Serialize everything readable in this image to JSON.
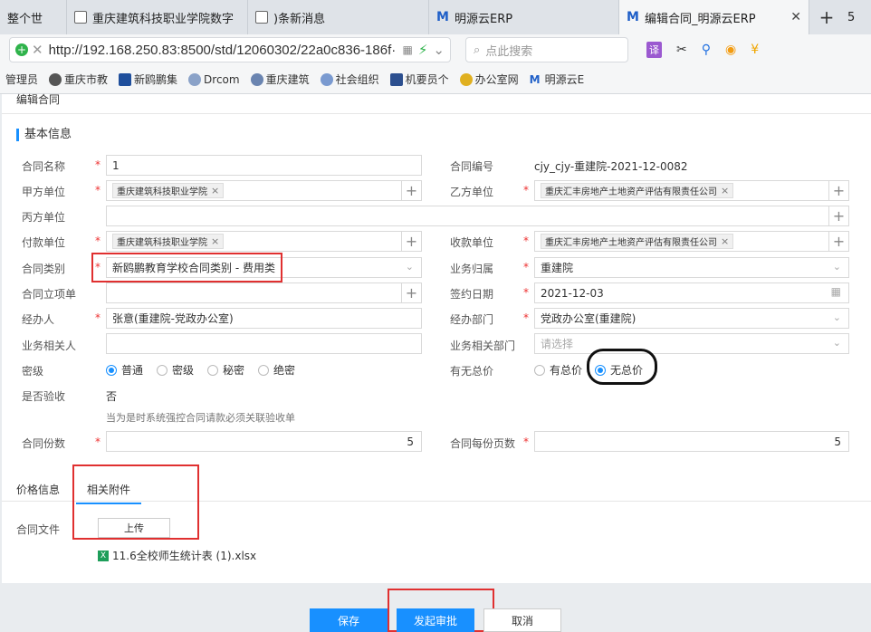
{
  "browser": {
    "tabs": [
      {
        "label": "整个世"
      },
      {
        "label": "重庆建筑科技职业学院数字"
      },
      {
        "label": ")条新消息"
      },
      {
        "label": "明源云ERP"
      },
      {
        "label": "编辑合同_明源云ERP"
      }
    ],
    "extra_tab_num": "5",
    "url": "http://192.168.250.83:8500/std/12060302/22a0c836-186f·",
    "search_placeholder": "点此搜索",
    "translate_label": "译",
    "bookmarks": [
      {
        "label": "管理员"
      },
      {
        "label": "重庆市教"
      },
      {
        "label": "新鸥鹏集"
      },
      {
        "label": "Drcom"
      },
      {
        "label": "重庆建筑"
      },
      {
        "label": "社会组织"
      },
      {
        "label": "机要员个"
      },
      {
        "label": "办公室网"
      },
      {
        "label": "明源云E"
      }
    ]
  },
  "page": {
    "title": "编辑合同",
    "section": "基本信息",
    "fields": {
      "contract_name": {
        "label": "合同名称",
        "value": "1"
      },
      "contract_no": {
        "label": "合同编号",
        "value": "cjy_cjy-重建院-2021-12-0082"
      },
      "party_a": {
        "label": "甲方单位",
        "value": "重庆建筑科技职业学院"
      },
      "party_b": {
        "label": "乙方单位",
        "value": "重庆汇丰房地产土地资产评估有限责任公司"
      },
      "party_c": {
        "label": "丙方单位",
        "value": ""
      },
      "payer": {
        "label": "付款单位",
        "value": "重庆建筑科技职业学院"
      },
      "payee": {
        "label": "收款单位",
        "value": "重庆汇丰房地产土地资产评估有限责任公司"
      },
      "category": {
        "label": "合同类别",
        "value": "新鸥鹏教育学校合同类别 - 费用类"
      },
      "business": {
        "label": "业务归属",
        "value": "重建院"
      },
      "project": {
        "label": "合同立项单",
        "value": ""
      },
      "sign_date": {
        "label": "签约日期",
        "value": "2021-12-03"
      },
      "handler": {
        "label": "经办人",
        "value": "张意(重建院-党政办公室)"
      },
      "dept": {
        "label": "经办部门",
        "value": "党政办公室(重建院)"
      },
      "related_person": {
        "label": "业务相关人",
        "value": ""
      },
      "related_dept": {
        "label": "业务相关部门",
        "placeholder": "请选择"
      },
      "secret": {
        "label": "密级",
        "options": [
          "普通",
          "密级",
          "秘密",
          "绝密"
        ]
      },
      "total_price": {
        "label": "有无总价",
        "options": [
          "有总价",
          "无总价"
        ]
      },
      "acceptance": {
        "label": "是否验收",
        "value": "否",
        "hint": "当为是时系统强控合同请款必须关联验收单"
      },
      "copies": {
        "label": "合同份数",
        "value": "5"
      },
      "pages": {
        "label": "合同每份页数",
        "value": "5"
      }
    },
    "tabs": [
      {
        "label": "价格信息"
      },
      {
        "label": "相关附件"
      }
    ],
    "attach_label": "合同文件",
    "upload_label": "上传",
    "file_icon": "X",
    "file_name": "11.6全校师生统计表 (1).xlsx"
  },
  "footer": {
    "save": "保存",
    "submit": "发起审批",
    "cancel": "取消"
  },
  "colors": {
    "primary": "#1890ff",
    "annotation_red": "#e03030"
  }
}
